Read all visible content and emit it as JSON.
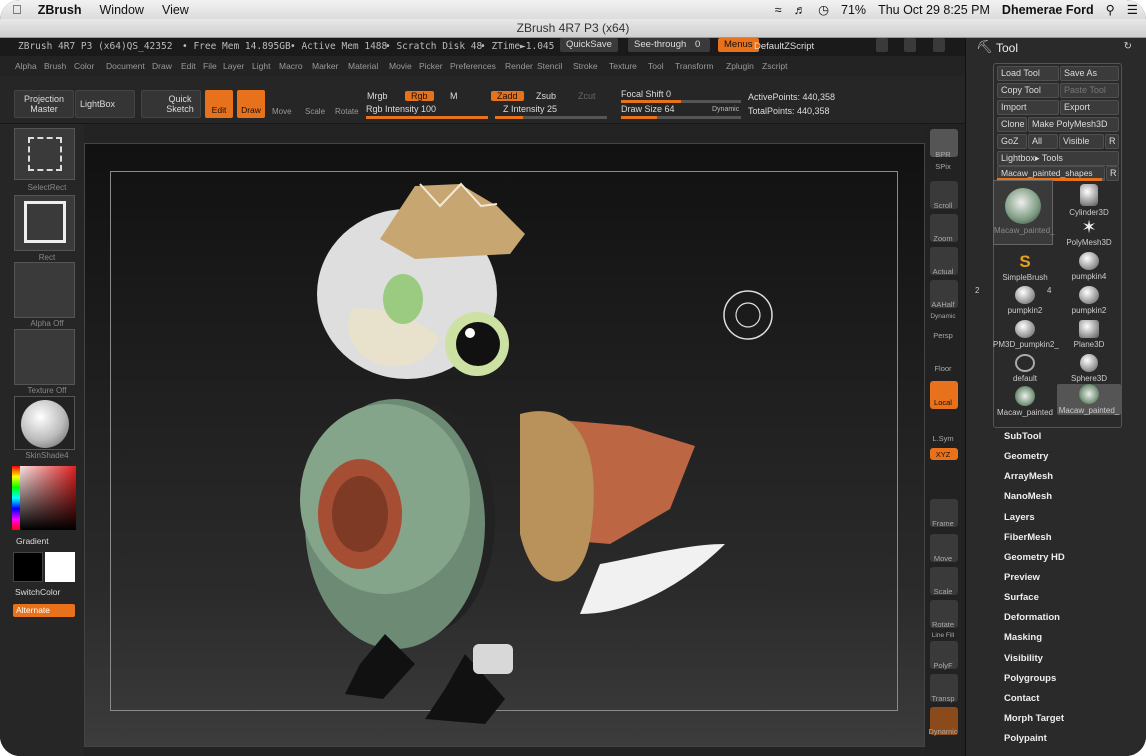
{
  "menubar": {
    "app": "ZBrush",
    "items": [
      "Window",
      "View"
    ],
    "battery": "71%",
    "clock": "Thu Oct 29  8:25 PM",
    "user": "Dhemerae Ford"
  },
  "window": {
    "title": "ZBrush 4R7 P3 (x64)"
  },
  "infobar": {
    "version": "ZBrush 4R7 P3 (x64)QS_42352",
    "free_mem": "• Free Mem 14.895GB",
    "active_mem": "• Active Mem 1488",
    "scratch": "• Scratch Disk 48",
    "ztime": "• ZTime►1.045",
    "quicksave": "QuickSave",
    "seethrough": "See-through",
    "seethrough_val": "0",
    "menus": "Menus",
    "default_script": "DefaultZScript"
  },
  "menus": [
    "Alpha",
    "Brush",
    "Color",
    "Document",
    "Draw",
    "Edit",
    "File",
    "Layer",
    "Light",
    "Macro",
    "Marker",
    "Material",
    "Movie",
    "Picker",
    "Preferences",
    "Render",
    "Stencil",
    "Stroke",
    "Texture",
    "Tool",
    "Transform",
    "Zplugin",
    "Zscript"
  ],
  "shelf": {
    "projection_master": "Projection Master",
    "lightbox": "LightBox",
    "quick_sketch": "Quick Sketch",
    "edit": "Edit",
    "draw": "Draw",
    "move": "Move",
    "scale": "Scale",
    "rotate": "Rotate",
    "mrgb": "Mrgb",
    "rgb": "Rgb",
    "m": "M",
    "rgb_intensity": "Rgb Intensity 100",
    "zadd": "Zadd",
    "zsub": "Zsub",
    "zcut": "Zcut",
    "z_intensity": "Z Intensity 25",
    "focal_shift": "Focal Shift 0",
    "draw_size": "Draw Size 64",
    "dynamic": "Dynamic",
    "active_points": "ActivePoints: 440,358",
    "total_points": "TotalPoints: 440,358"
  },
  "left_tray": {
    "select_rect": "SelectRect",
    "rect": "Rect",
    "alpha": "Alpha Off",
    "texture": "Texture Off",
    "material": "SkinShade4",
    "gradient": "Gradient",
    "switch_color": "SwitchColor",
    "alternate": "Alternate"
  },
  "right_tray": [
    "BPR",
    "SPix",
    "Scroll",
    "Zoom",
    "Actual",
    "AAHalf",
    "Dynamic",
    "Persp",
    "Floor",
    "Local",
    "L.Sym",
    "XYZ",
    "Frame",
    "Move",
    "Scale",
    "Rotate",
    "Line Fill",
    "PolyF",
    "Transp",
    "Dynamic"
  ],
  "tool_panel": {
    "title": "Tool",
    "load_tool": "Load Tool",
    "save_as": "Save As",
    "copy_tool": "Copy Tool",
    "paste_tool": "Paste Tool",
    "import": "Import",
    "export": "Export",
    "clone": "Clone",
    "make_polymesh": "Make PolyMesh3D",
    "goz": "GoZ",
    "all": "All",
    "visible": "Visible",
    "r": "R",
    "lightbox_tools": "Lightbox▸ Tools",
    "current_tool": "Macaw_painted_shapes",
    "thumbs": [
      {
        "name": "Macaw_painted_"
      },
      {
        "name": "Cylinder3D"
      },
      {
        "name": "PolyMesh3D"
      },
      {
        "name": "SimpleBrush"
      },
      {
        "name": "pumpkin4"
      },
      {
        "name": "pumpkin2",
        "count": "2"
      },
      {
        "name": "pumpkin2",
        "count": "4"
      },
      {
        "name": "PM3D_pumpkin2_"
      },
      {
        "name": "Plane3D"
      },
      {
        "name": "default"
      },
      {
        "name": "Sphere3D"
      },
      {
        "name": "Macaw_painted"
      },
      {
        "name": "Macaw_painted_"
      }
    ],
    "subpalettes": [
      "SubTool",
      "Geometry",
      "ArrayMesh",
      "NanoMesh",
      "Layers",
      "FiberMesh",
      "Geometry HD",
      "Preview",
      "Surface",
      "Deformation",
      "Masking",
      "Visibility",
      "Polygroups",
      "Contact",
      "Morph Target",
      "Polypaint"
    ]
  }
}
